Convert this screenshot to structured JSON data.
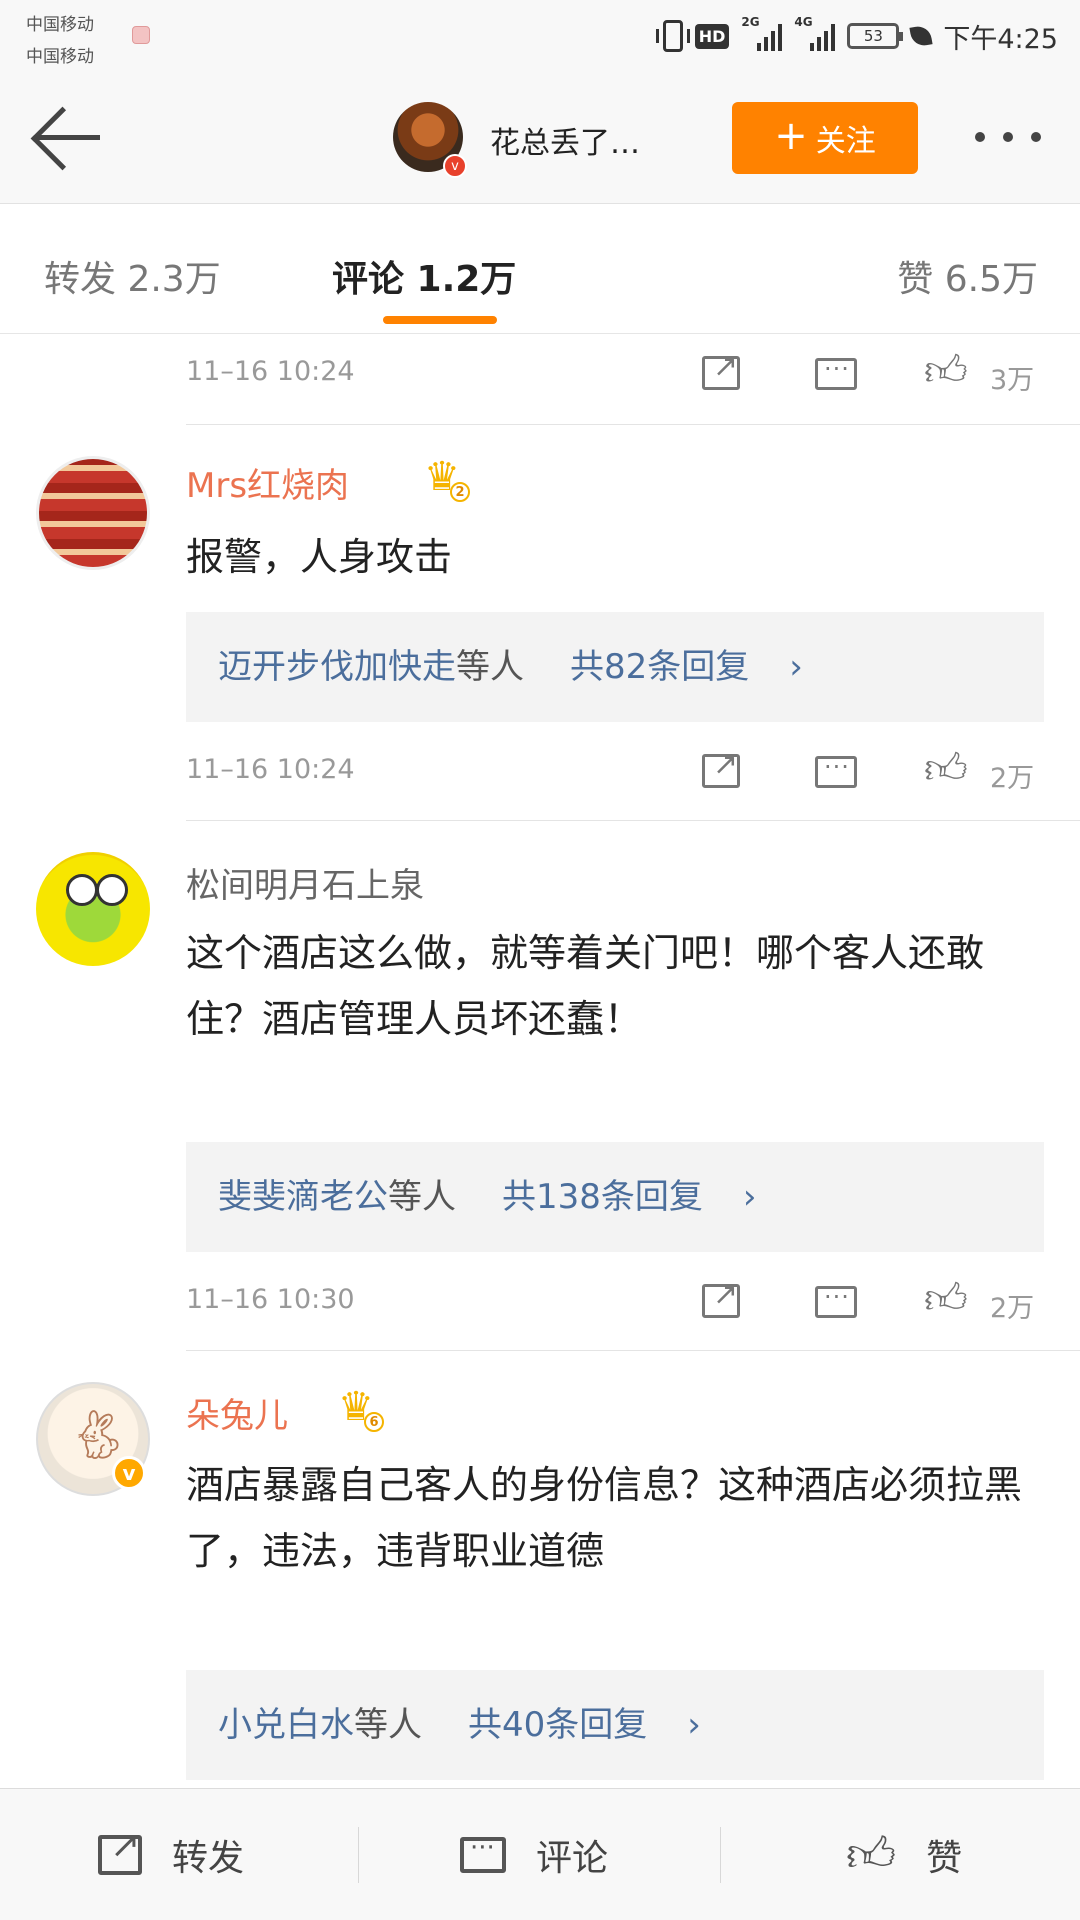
{
  "status_bar": {
    "carrier_1": "中国移动",
    "carrier_2": "中国移动",
    "hd": "HD",
    "net_1": "2G",
    "net_2": "4G",
    "battery": "53",
    "time": "下午4:25"
  },
  "header": {
    "author_name": "花总丢了…",
    "follow_label": "关注",
    "follow_icon": "plus-icon"
  },
  "tabs": {
    "repost": "转发 2.3万",
    "comment": "评论 1.2万",
    "like": "赞 6.5万"
  },
  "top_meta": {
    "time": "11–16  10:24",
    "likes": "3万"
  },
  "comments": [
    {
      "user": "Mrs红烧肉",
      "vip_level": "2",
      "text": "报警，人身攻击",
      "reply_names": "迈开步伐加快走",
      "reply_etc": "等人",
      "reply_total": "共82条回复",
      "time": "11–16  10:24",
      "likes": "2万"
    },
    {
      "user": "松间明月石上泉",
      "text": "这个酒店这么做，就等着关门吧！哪个客人还敢住？酒店管理人员坏还蠢！",
      "reply_names": "斐斐滴老公",
      "reply_etc": "等人",
      "reply_total": "共138条回复",
      "time": "11–16  10:30",
      "likes": "2万"
    },
    {
      "user": "朵兔儿",
      "vip_level": "6",
      "text": "酒店暴露自己客人的身份信息？这种酒店必须拉黑了，违法，违背职业道德",
      "reply_names": "小兑白水",
      "reply_etc": "等人",
      "reply_total": "共40条回复"
    }
  ],
  "bottom_bar": {
    "repost": "转发",
    "comment": "评论",
    "like": "赞"
  },
  "colors": {
    "accent": "#ff8200",
    "vip_name": "#eb7350",
    "link": "#4b6e9c"
  }
}
